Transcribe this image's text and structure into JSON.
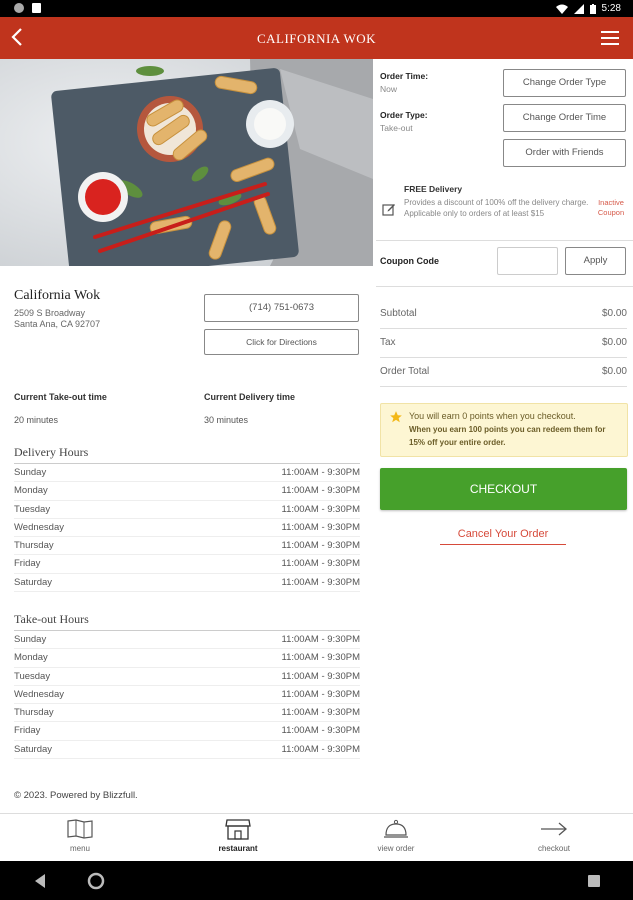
{
  "status_bar": {
    "time": "5:28"
  },
  "app_bar": {
    "title": "CALIFORNIA WOK"
  },
  "restaurant": {
    "name": "California Wok",
    "address_line1": "2509 S Broadway",
    "address_line2": "Santa Ana, CA 92707",
    "phone": "(714) 751-0673",
    "directions_label": "Click for Directions",
    "takeout_time_label": "Current Take-out time",
    "takeout_time": "20 minutes",
    "delivery_time_label": "Current Delivery time",
    "delivery_time": "30 minutes"
  },
  "delivery_hours": {
    "title": "Delivery Hours",
    "rows": [
      {
        "day": "Sunday",
        "hours": "11:00AM - 9:30PM"
      },
      {
        "day": "Monday",
        "hours": "11:00AM - 9:30PM"
      },
      {
        "day": "Tuesday",
        "hours": "11:00AM - 9:30PM"
      },
      {
        "day": "Wednesday",
        "hours": "11:00AM - 9:30PM"
      },
      {
        "day": "Thursday",
        "hours": "11:00AM - 9:30PM"
      },
      {
        "day": "Friday",
        "hours": "11:00AM - 9:30PM"
      },
      {
        "day": "Saturday",
        "hours": "11:00AM - 9:30PM"
      }
    ]
  },
  "takeout_hours": {
    "title": "Take-out Hours",
    "rows": [
      {
        "day": "Sunday",
        "hours": "11:00AM - 9:30PM"
      },
      {
        "day": "Monday",
        "hours": "11:00AM - 9:30PM"
      },
      {
        "day": "Tuesday",
        "hours": "11:00AM - 9:30PM"
      },
      {
        "day": "Wednesday",
        "hours": "11:00AM - 9:30PM"
      },
      {
        "day": "Thursday",
        "hours": "11:00AM - 9:30PM"
      },
      {
        "day": "Friday",
        "hours": "11:00AM - 9:30PM"
      },
      {
        "day": "Saturday",
        "hours": "11:00AM - 9:30PM"
      }
    ]
  },
  "footer": {
    "text": "© 2023. Powered by Blizzfull."
  },
  "order": {
    "time_label": "Order Time:",
    "time_value": "Now",
    "type_label": "Order Type:",
    "type_value": "Take-out",
    "change_type_label": "Change Order Type",
    "change_time_label": "Change Order Time",
    "friends_label": "Order with Friends"
  },
  "promo": {
    "title": "FREE Delivery",
    "description": "Provides a discount of 100% off the delivery charge. Applicable only to orders of at least $15",
    "status_line1": "Inactive",
    "status_line2": "Coupon"
  },
  "coupon": {
    "label": "Coupon Code",
    "value": "",
    "apply_label": "Apply"
  },
  "summary": {
    "subtotal_label": "Subtotal",
    "subtotal": "$0.00",
    "tax_label": "Tax",
    "tax": "$0.00",
    "total_label": "Order Total",
    "total": "$0.00"
  },
  "points": {
    "line1": "You will earn 0 points when you checkout.",
    "line2": "When you earn 100 points you can redeem them for 15% off your entire order."
  },
  "checkout_label": "CHECKOUT",
  "cancel_label": "Cancel Your Order",
  "bottom_nav": [
    {
      "label": "menu"
    },
    {
      "label": "restaurant"
    },
    {
      "label": "view order"
    },
    {
      "label": "checkout"
    }
  ],
  "colors": {
    "brand": "#c0341d",
    "checkout": "#46a02b",
    "points_bg": "#fdf6d3"
  }
}
